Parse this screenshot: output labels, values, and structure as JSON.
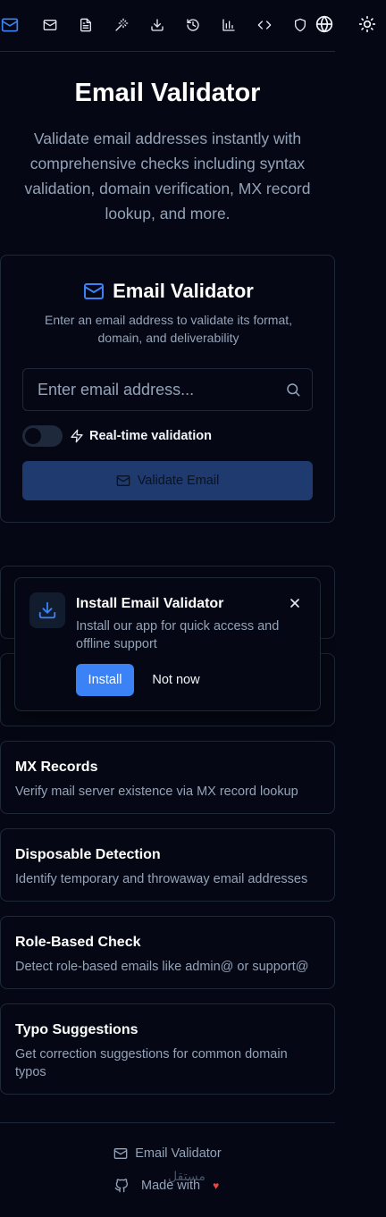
{
  "nav": {
    "items": [
      {
        "icon": "mail-icon",
        "active": true
      },
      {
        "icon": "mail-icon",
        "active": false
      },
      {
        "icon": "file-text-icon",
        "active": false
      },
      {
        "icon": "magic-wand-icon",
        "active": false
      },
      {
        "icon": "download-icon",
        "active": false
      },
      {
        "icon": "history-icon",
        "active": false
      },
      {
        "icon": "bar-chart-icon",
        "active": false
      },
      {
        "icon": "code-icon",
        "active": false
      },
      {
        "icon": "shield-icon",
        "active": false
      }
    ],
    "language_icon": "globe-icon",
    "theme_icon": "sun-icon"
  },
  "hero": {
    "title": "Email Validator",
    "subtitle": "Validate email addresses instantly with comprehensive checks including syntax validation, domain verification, MX record lookup, and more."
  },
  "validator": {
    "title": "Email Validator",
    "description": "Enter an email address to validate its format, domain, and deliverability",
    "input_value": "",
    "input_placeholder": "Enter email address...",
    "realtime_label": "Real-time validation",
    "realtime_enabled": false,
    "validate_label": "Validate Email"
  },
  "features": [
    {
      "title": "MX Records",
      "description": "Verify mail server existence via MX record lookup"
    },
    {
      "title": "Disposable Detection",
      "description": "Identify temporary and throwaway email addresses"
    },
    {
      "title": "Role-Based Check",
      "description": "Detect role-based emails like admin@ or support@"
    },
    {
      "title": "Typo Suggestions",
      "description": "Get correction suggestions for common domain typos"
    }
  ],
  "install_popup": {
    "title": "Install Email Validator",
    "description": "Install our app for quick access and offline support",
    "install_label": "Install",
    "dismiss_label": "Not now"
  },
  "footer": {
    "brand": "Email Validator",
    "made_with": "Made with",
    "watermark": "مستقل"
  },
  "colors": {
    "accent": "#3b82f6",
    "background": "#050814",
    "border": "#1f2937",
    "muted_text": "#94a3b8",
    "heart": "#ef4444"
  }
}
